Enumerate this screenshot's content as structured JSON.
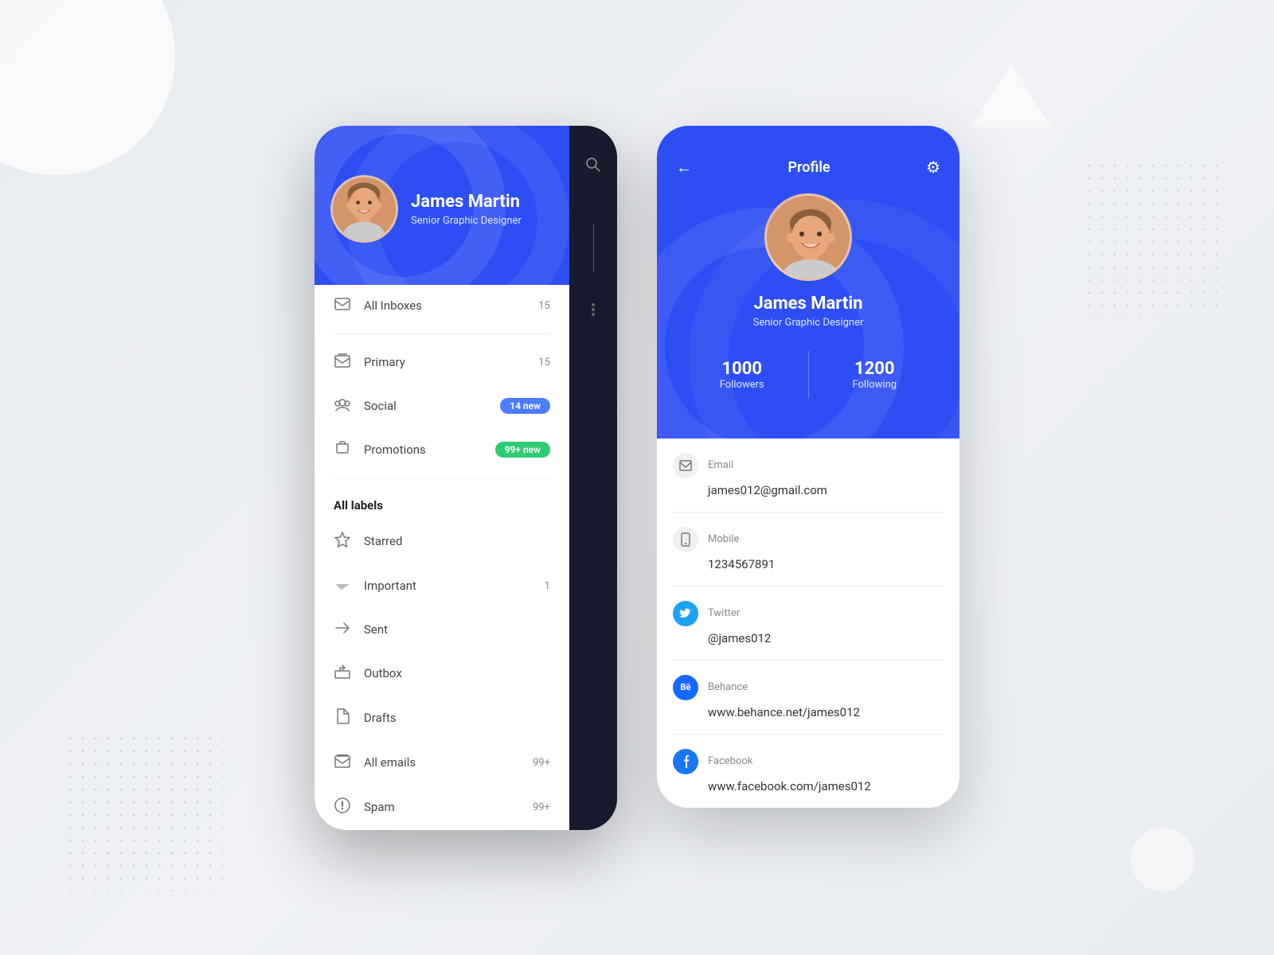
{
  "background": {
    "color": "#edf0f5"
  },
  "phone1": {
    "profile": {
      "name": "James Martin",
      "title": "Senior Graphic Designer"
    },
    "menu": {
      "all_inboxes_label": "All Inboxes",
      "all_inboxes_count": "15",
      "section_divider": true,
      "items": [
        {
          "icon": "✉",
          "label": "Primary",
          "badge": "15",
          "badge_type": "number"
        },
        {
          "icon": "👥",
          "label": "Social",
          "badge": "14 new",
          "badge_type": "blue"
        },
        {
          "icon": "🏷",
          "label": "Promotions",
          "badge": "99+ new",
          "badge_type": "green"
        }
      ],
      "labels_title": "All labels",
      "label_items": [
        {
          "icon": "★",
          "label": "Starred",
          "badge": ""
        },
        {
          "icon": "▶",
          "label": "Important",
          "badge": "1"
        },
        {
          "icon": "➤",
          "label": "Sent",
          "badge": ""
        },
        {
          "icon": "⬆",
          "label": "Outbox",
          "badge": ""
        },
        {
          "icon": "📄",
          "label": "Drafts",
          "badge": ""
        },
        {
          "icon": "✉",
          "label": "All emails",
          "badge": "99+"
        },
        {
          "icon": "⚠",
          "label": "Spam",
          "badge": "99+"
        }
      ]
    }
  },
  "phone2": {
    "nav": {
      "back_icon": "←",
      "title": "Profile",
      "settings_icon": "⚙"
    },
    "profile": {
      "name": "James Martin",
      "title": "Senior Graphic Designer",
      "followers": "1000",
      "followers_label": "Followers",
      "following": "1200",
      "following_label": "Following"
    },
    "contact_info": [
      {
        "type": "Email",
        "value": "james012@gmail.com",
        "icon_type": "email"
      },
      {
        "type": "Mobile",
        "value": "1234567891",
        "icon_type": "mobile"
      },
      {
        "type": "Twitter",
        "value": "@james012",
        "icon_type": "twitter"
      },
      {
        "type": "Behance",
        "value": "www.behance.net/james012",
        "icon_type": "behance"
      },
      {
        "type": "Facebook",
        "value": "www.facebook.com/james012",
        "icon_type": "facebook"
      }
    ]
  }
}
